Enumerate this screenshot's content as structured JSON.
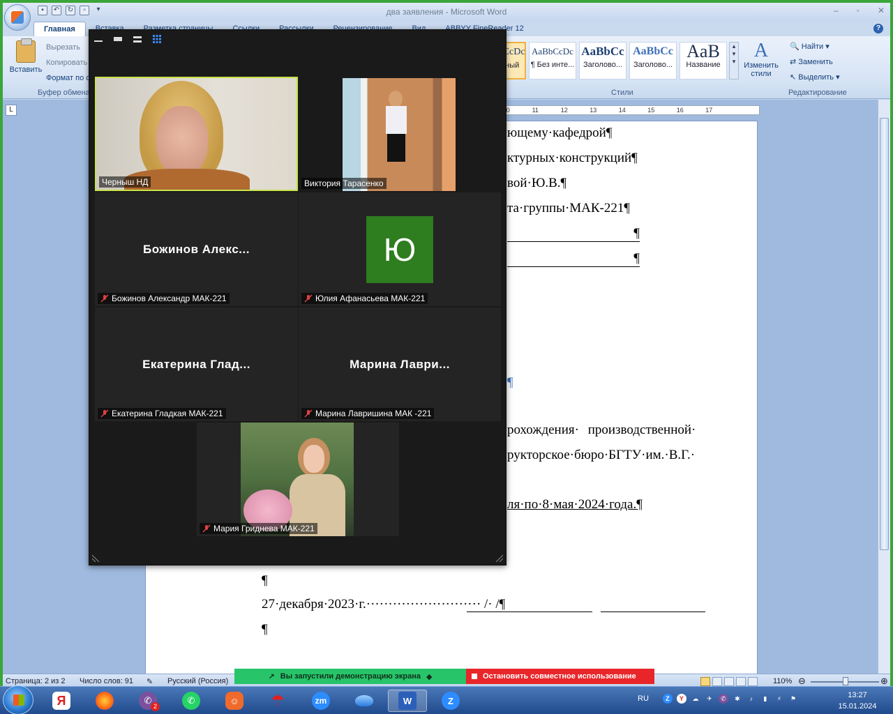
{
  "word": {
    "title": "два заявления - Microsoft Word",
    "tabs": [
      "Главная",
      "Вставка",
      "Разметка страницы",
      "Ссылки",
      "Рассылки",
      "Рецензирование",
      "Вид",
      "ABBYY FineReader 12"
    ],
    "clipboard": {
      "paste": "Вставить",
      "cut": "Вырезать",
      "copy": "Копировать",
      "format": "Формат по образцу",
      "group": "Буфер обмена"
    },
    "styles": [
      {
        "sample": "AaBbCcDc",
        "name": "Обычный"
      },
      {
        "sample": "AaBbCcDc",
        "name": "¶ Без инте..."
      },
      {
        "sample": "AaBbCc",
        "name": "Заголово..."
      },
      {
        "sample": "AaBbCc",
        "name": "Заголово..."
      },
      {
        "sample": "AaB",
        "name": "Название"
      }
    ],
    "styles_group": "Стили",
    "change_styles": "Изменить стили",
    "editing": {
      "find": "Найти",
      "replace": "Заменить",
      "select": "Выделить",
      "group": "Редактирование"
    },
    "ruler": [
      "10",
      "11",
      "12",
      "13",
      "14",
      "15",
      "16",
      "17"
    ],
    "doc_lines": [
      "ющему·кафедрой¶",
      "ктурных·конструкций¶",
      "вой·Ю.В.¶",
      "та·группы·МАК-221¶",
      "¶",
      "¶",
      "¶",
      "рохождения·   производственной·",
      "рукторское·бюро·БГТУ·им.·В.Г.·",
      "ля·по·8·мая·2024·года.¶",
      "¶",
      "27·декабря·2023·г.··························   /·   /¶",
      "¶"
    ],
    "status": {
      "page": "Страница: 2 из 2",
      "words": "Число слов: 91",
      "lang": "Русский (Россия)",
      "zoom": "110%"
    }
  },
  "share_banner": {
    "message": "Вы запустили демонстрацию экрана",
    "stop": "Остановить совместное использование"
  },
  "zoom": {
    "participants": [
      {
        "name": "Черныш НД",
        "big": "",
        "muted": false
      },
      {
        "name": "Виктория Тарасенко",
        "big": "",
        "muted": false
      },
      {
        "name": "Божинов Александр МАК-221",
        "big": "Божинов  Алекс...",
        "muted": true
      },
      {
        "name": "Юлия Афанасьева МАК-221",
        "big": "Ю",
        "muted": true
      },
      {
        "name": "Екатерина Гладкая МАК-221",
        "big": "Екатерина  Глад...",
        "muted": true
      },
      {
        "name": "Марина Лавришина МАК -221",
        "big": "Марина  Лаври...",
        "muted": true
      },
      {
        "name": "Мария Гриднева МАК-221",
        "big": "",
        "muted": true
      }
    ],
    "avatar_color": "#2e7d1f"
  },
  "taskbar": {
    "lang": "RU",
    "time": "13:27",
    "date": "15.01.2024",
    "viber_badge": "2"
  }
}
